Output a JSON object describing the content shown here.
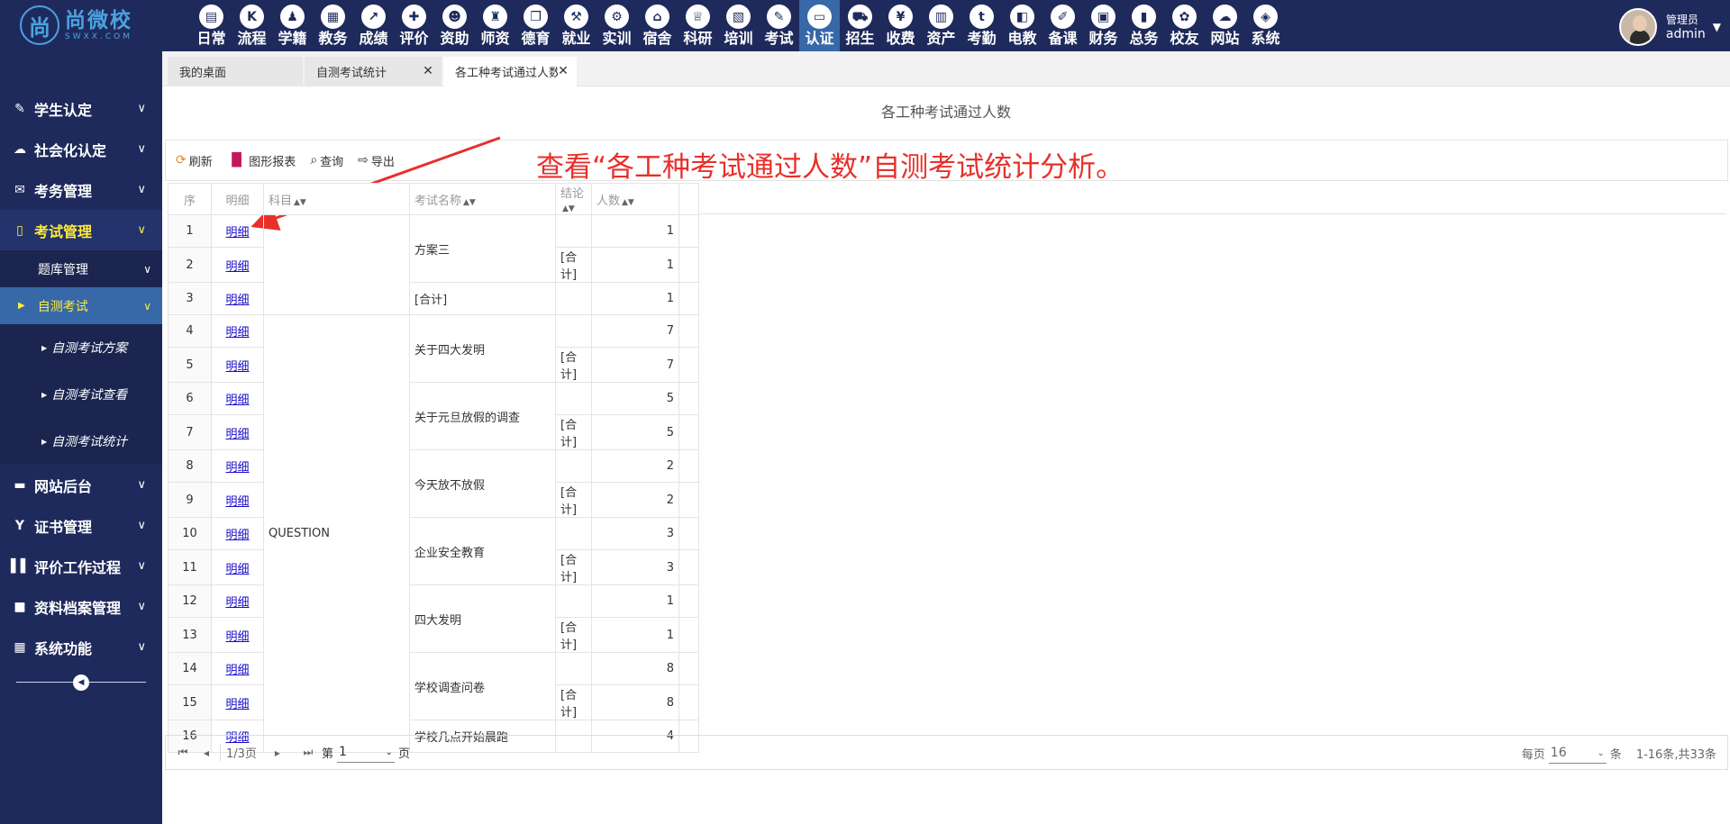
{
  "brand": {
    "mark": "尚",
    "name": "尚微校",
    "sub": "SWXX.COM"
  },
  "nav": [
    {
      "label": "日常",
      "icon": "▤"
    },
    {
      "label": "流程",
      "icon": "K"
    },
    {
      "label": "学籍",
      "icon": "♟"
    },
    {
      "label": "教务",
      "icon": "▦"
    },
    {
      "label": "成绩",
      "icon": "↗"
    },
    {
      "label": "评价",
      "icon": "✚"
    },
    {
      "label": "资助",
      "icon": "☻"
    },
    {
      "label": "师资",
      "icon": "♜"
    },
    {
      "label": "德育",
      "icon": "❒"
    },
    {
      "label": "就业",
      "icon": "⚒"
    },
    {
      "label": "实训",
      "icon": "⚙"
    },
    {
      "label": "宿舍",
      "icon": "⌂"
    },
    {
      "label": "科研",
      "icon": "♕"
    },
    {
      "label": "培训",
      "icon": "▧"
    },
    {
      "label": "考试",
      "icon": "✎"
    },
    {
      "label": "认证",
      "icon": "▭"
    },
    {
      "label": "招生",
      "icon": "⛟"
    },
    {
      "label": "收费",
      "icon": "¥"
    },
    {
      "label": "资产",
      "icon": "▥"
    },
    {
      "label": "考勤",
      "icon": "t"
    },
    {
      "label": "电教",
      "icon": "◧"
    },
    {
      "label": "备课",
      "icon": "✐"
    },
    {
      "label": "财务",
      "icon": "▣"
    },
    {
      "label": "总务",
      "icon": "▮"
    },
    {
      "label": "校友",
      "icon": "✿"
    },
    {
      "label": "网站",
      "icon": "☁"
    },
    {
      "label": "系统",
      "icon": "◈"
    }
  ],
  "nav_active": "认证",
  "user": {
    "role": "管理员",
    "name": "admin"
  },
  "sidebar": {
    "items": [
      {
        "label": "学生认定",
        "icon": "✎"
      },
      {
        "label": "社会化认定",
        "icon": "☁"
      },
      {
        "label": "考务管理",
        "icon": "✉"
      },
      {
        "label": "考试管理",
        "icon": "▯"
      },
      {
        "label": "题库管理"
      },
      {
        "label": "自测考试"
      },
      {
        "label": "自测考试方案"
      },
      {
        "label": "自测考试查看"
      },
      {
        "label": "自测考试统计"
      },
      {
        "label": "网站后台",
        "icon": "▬"
      },
      {
        "label": "证书管理",
        "icon": "Y"
      },
      {
        "label": "评价工作过程",
        "icon": "▌▌"
      },
      {
        "label": "资料档案管理",
        "icon": "■"
      },
      {
        "label": "系统功能",
        "icon": "▦"
      }
    ]
  },
  "tabs": [
    {
      "label": "我的桌面"
    },
    {
      "label": "自测考试统计"
    },
    {
      "label": "各工种考试通过人数"
    }
  ],
  "page_title": "各工种考试通过人数",
  "toolbar": {
    "refresh": "刷新",
    "chart": "图形报表",
    "query": "查询",
    "export": "导出"
  },
  "annotation": "查看“各工种考试通过人数”自测考试统计分析。",
  "table": {
    "headers": {
      "idx": "序",
      "detail": "明细",
      "subject": "科目",
      "exam": "考试名称",
      "result": "结论",
      "count": "人数"
    },
    "detail_link": "明细",
    "subject_question": "QUESTION",
    "exams": [
      "方案三",
      "关于四大发明",
      "关于元旦放假的调查",
      "今天放不放假",
      "企业安全教育",
      "四大发明",
      "学校调查问卷",
      "学校几点开始晨跑"
    ],
    "total_label": "[合计]",
    "rows": [
      {
        "idx": "1",
        "count": "1"
      },
      {
        "idx": "2",
        "count": "1"
      },
      {
        "idx": "3",
        "count": "1"
      },
      {
        "idx": "4",
        "count": "7"
      },
      {
        "idx": "5",
        "count": "7"
      },
      {
        "idx": "6",
        "count": "5"
      },
      {
        "idx": "7",
        "count": "5"
      },
      {
        "idx": "8",
        "count": "2"
      },
      {
        "idx": "9",
        "count": "2"
      },
      {
        "idx": "10",
        "count": "3"
      },
      {
        "idx": "11",
        "count": "3"
      },
      {
        "idx": "12",
        "count": "1"
      },
      {
        "idx": "13",
        "count": "1"
      },
      {
        "idx": "14",
        "count": "8"
      },
      {
        "idx": "15",
        "count": "8"
      },
      {
        "idx": "16",
        "count": "4"
      }
    ]
  },
  "pager": {
    "page_info": "1/3页",
    "page_prefix": "第",
    "page_value": "1",
    "page_suffix": "页",
    "per_page_prefix": "每页",
    "per_page_value": "16",
    "per_page_suffix": "条",
    "range": "1-16条,共33条"
  },
  "colors": {
    "nav_bg": "#1f2a5c",
    "active": "#3768a8",
    "highlight": "#ffeb3b",
    "annotation": "#e8302b",
    "link": "#1a0dcc"
  }
}
